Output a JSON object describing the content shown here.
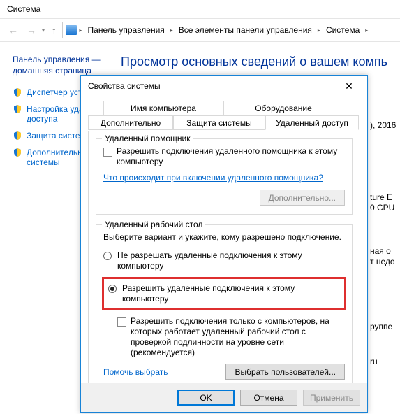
{
  "parent": {
    "title": "Система",
    "breadcrumbs": [
      "Панель управления",
      "Все элементы панели управления",
      "Система"
    ],
    "sidebar": {
      "home1": "Панель управления —",
      "home2": "домашняя страница",
      "tasks": [
        "Диспетчер устр",
        "Настройка уда",
        "доступа",
        "Защита систем",
        "Дополнительн",
        "системы"
      ]
    },
    "heading": "Просмотр основных сведений о вашем компь",
    "edge": {
      "a": "), 2016",
      "b": "ture E",
      "c": "0 CPU",
      "d": "ная о",
      "e": "т недо",
      "f": "руппе",
      "g": "ru"
    }
  },
  "dialog": {
    "title": "Свойства системы",
    "tabs": {
      "row1": [
        "Имя компьютера",
        "Оборудование"
      ],
      "row2": [
        "Дополнительно",
        "Защита системы",
        "Удаленный доступ"
      ]
    },
    "assist": {
      "group_title": "Удаленный помощник",
      "cb_label": "Разрешить подключения удаленного помощника к этому компьютеру",
      "link": "Что происходит при включении удаленного помощника?",
      "btn": "Дополнительно..."
    },
    "rdp": {
      "group_title": "Удаленный рабочий стол",
      "desc": "Выберите вариант и укажите, кому разрешено подключение.",
      "opt_deny": "Не разрешать удаленные подключения к этому компьютеру",
      "opt_allow": "Разрешить удаленные подключения к этому компьютеру",
      "nla_label": "Разрешить подключения только с компьютеров, на которых работает удаленный рабочий стол с проверкой подлинности на уровне сети (рекомендуется)",
      "help_link": "Помочь выбрать",
      "select_users": "Выбрать пользователей..."
    },
    "buttons": {
      "ok": "OK",
      "cancel": "Отмена",
      "apply": "Применить"
    }
  }
}
